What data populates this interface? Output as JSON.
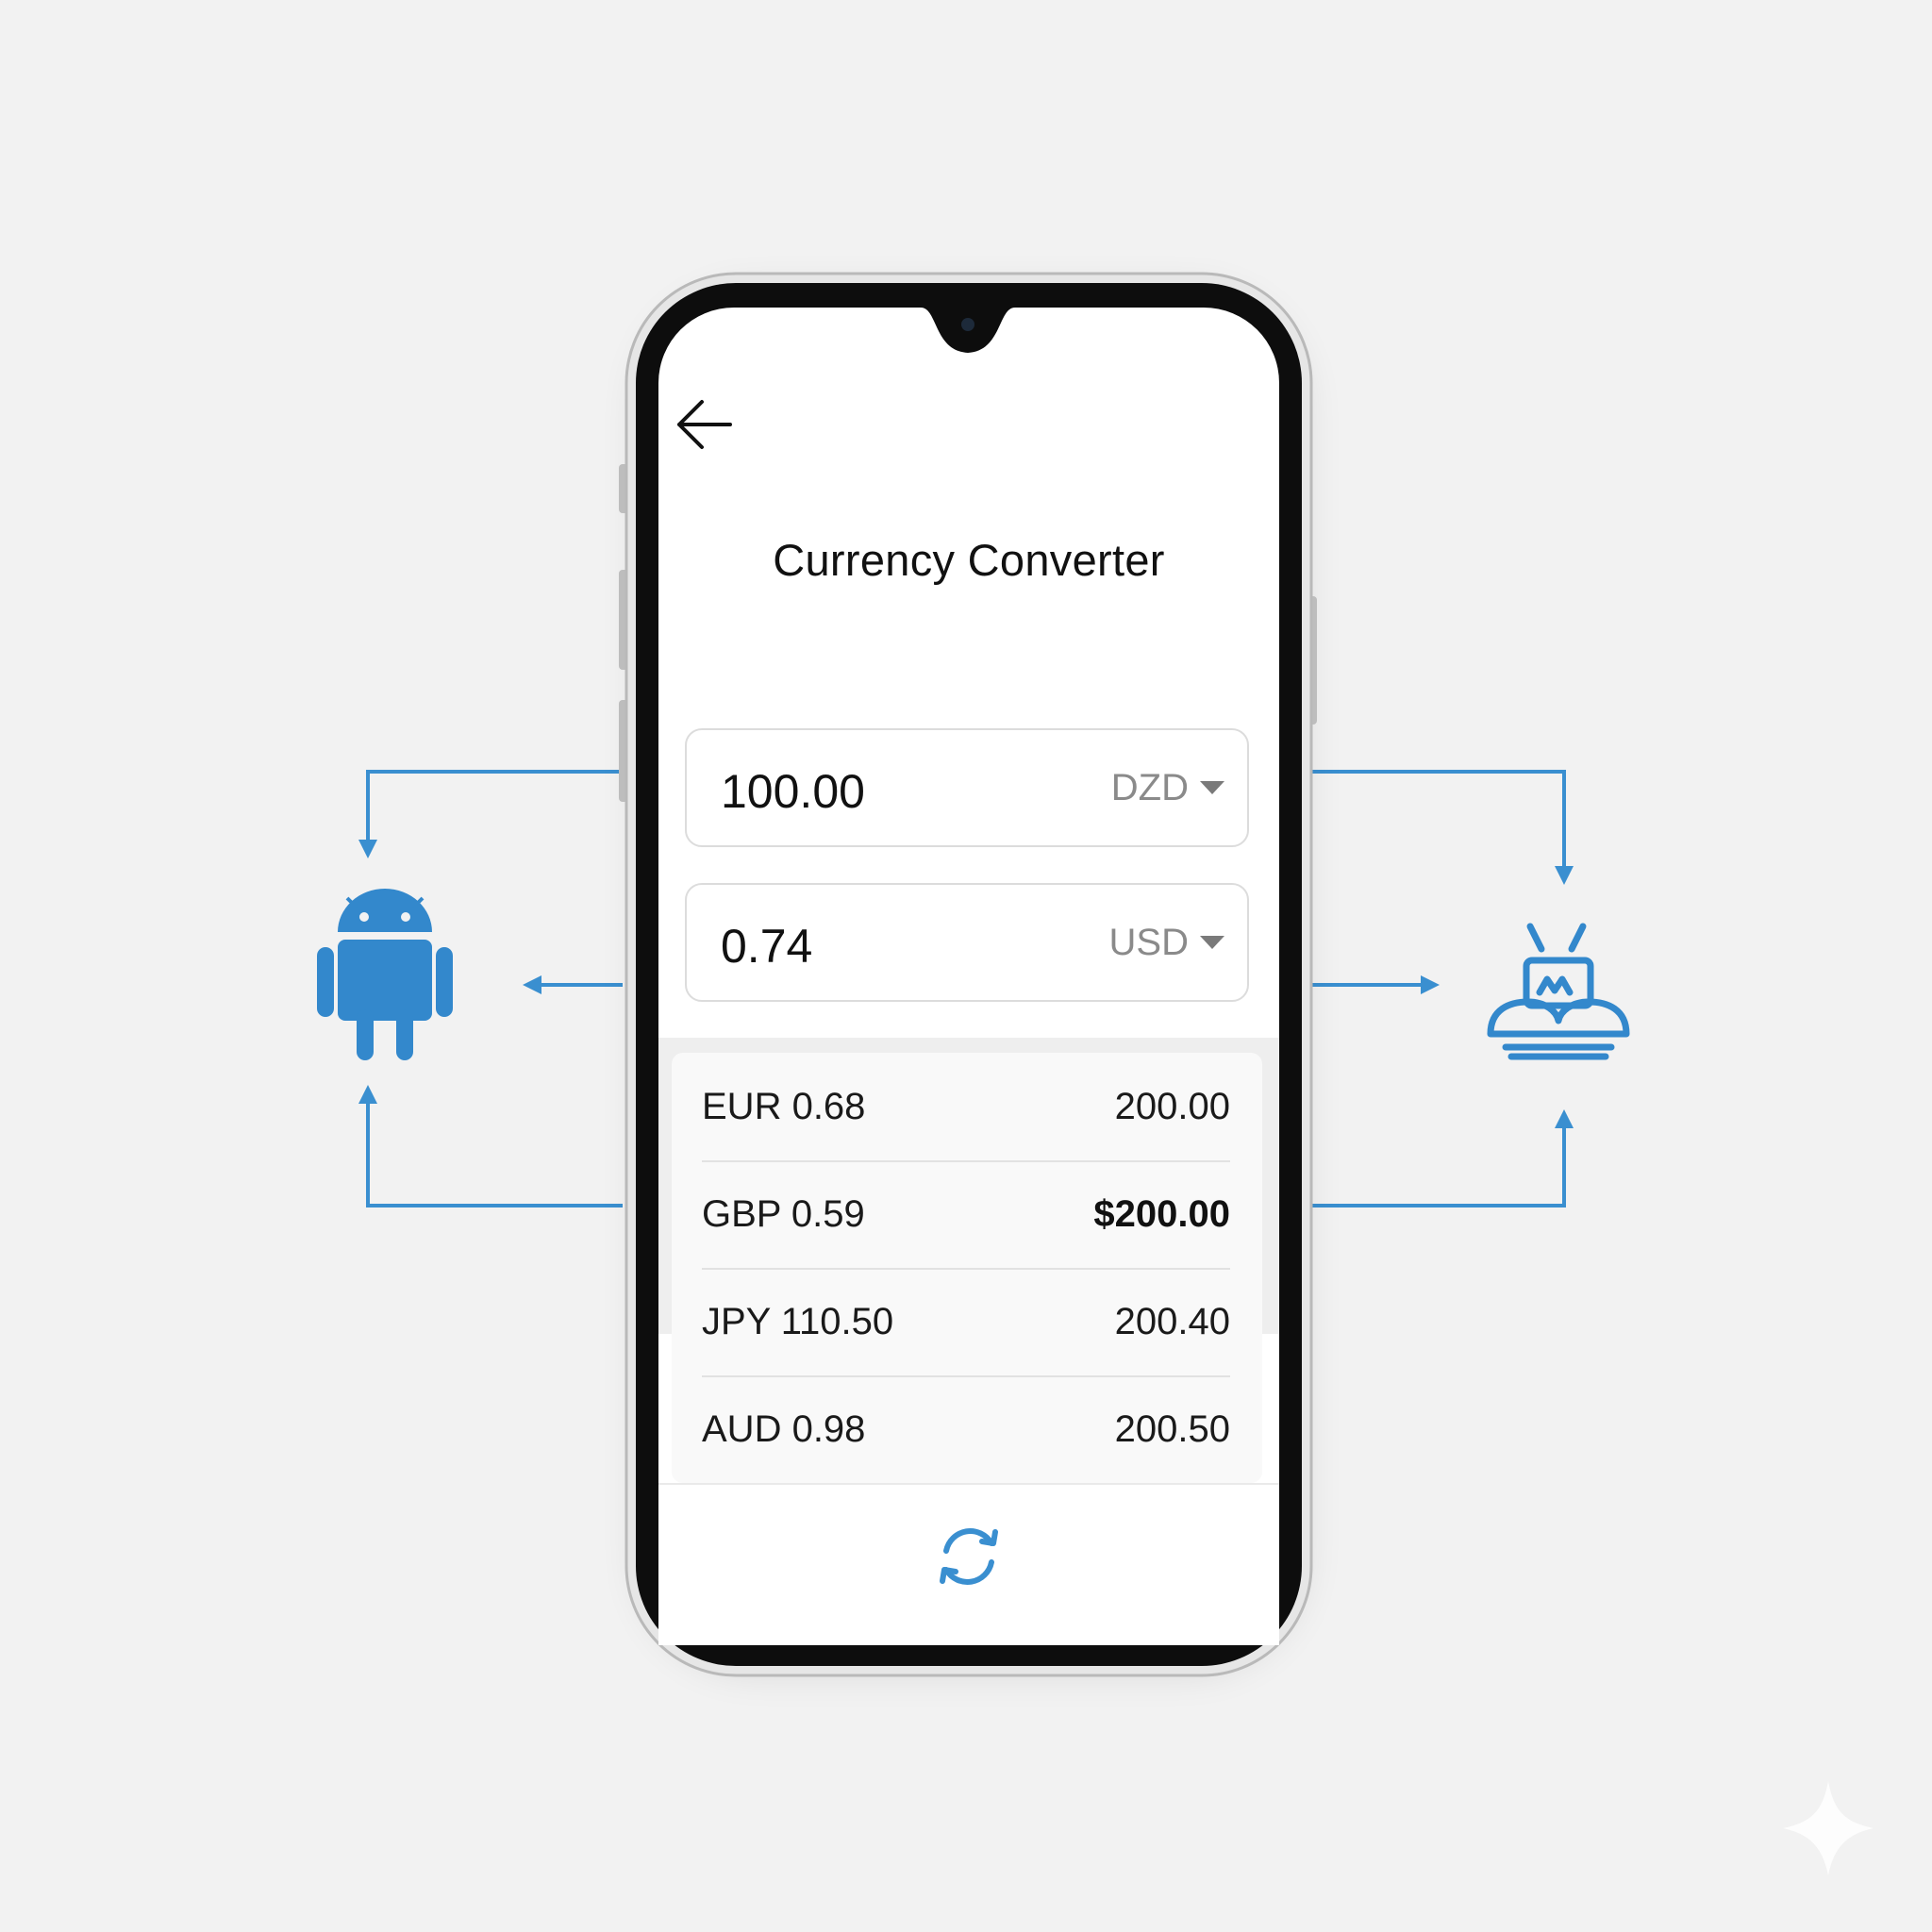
{
  "screen": {
    "title": "Currency Converter"
  },
  "converter": {
    "from": {
      "value": "100.00",
      "currency": "DZD"
    },
    "to": {
      "value": "0.74",
      "currency": "USD"
    }
  },
  "rates": [
    {
      "label": "EUR 0.68",
      "amount": "200.00",
      "emphasized": false
    },
    {
      "label": "GBP 0.59",
      "amount": "$200.00",
      "emphasized": true
    },
    {
      "label": "JPY 110.50",
      "amount": "200.40",
      "emphasized": false
    },
    {
      "label": "AUD 0.98",
      "amount": "200.50",
      "emphasized": false
    }
  ],
  "icons": {
    "back": "arrow-left-icon",
    "dropdown": "caret-down-icon",
    "refresh": "refresh-icon",
    "android": "android-icon",
    "device": "robot-device-icon",
    "watermark": "sparkle-icon"
  },
  "colors": {
    "background": "#f2f2f2",
    "accent": "#3a8fd0",
    "icon_blue": "#3388cc",
    "phone_frame": "#0d0d0d",
    "text": "#111111",
    "muted": "#8a8a8a"
  }
}
